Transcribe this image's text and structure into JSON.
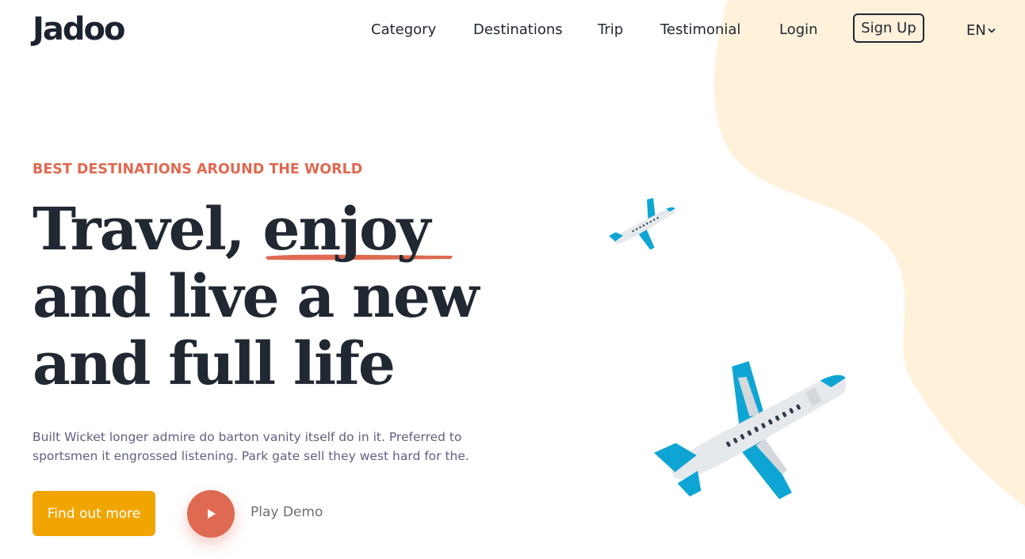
{
  "brand": {
    "name": "Jadoo"
  },
  "nav": {
    "items": [
      "Category",
      "Destinations",
      "Trip",
      "Testimonial",
      "Login"
    ],
    "signup_label": "Sign Up",
    "language": "EN",
    "language_icon": "chevron-down-icon"
  },
  "hero": {
    "eyebrow": "BEST DESTINATIONS AROUND THE WORLD",
    "headline_line1_a": "Travel, ",
    "headline_line1_b": "enjoy",
    "headline_line2": "and live a new",
    "headline_line3": "and full life",
    "description": "Built Wicket longer admire do barton vanity itself do in it. Preferred to sportsmen it engrossed listening. Park gate sell they west hard for the.",
    "cta_label": "Find out more",
    "play_label": "Play Demo",
    "play_icon": "play-icon"
  },
  "colors": {
    "accent_orange": "#f1a501",
    "accent_red": "#df6951",
    "blob": "#fff1da",
    "text_dark": "#212832",
    "text_muted": "#5e6282",
    "plane_blue": "#0ea5d4",
    "plane_body": "#e6e9ec"
  }
}
